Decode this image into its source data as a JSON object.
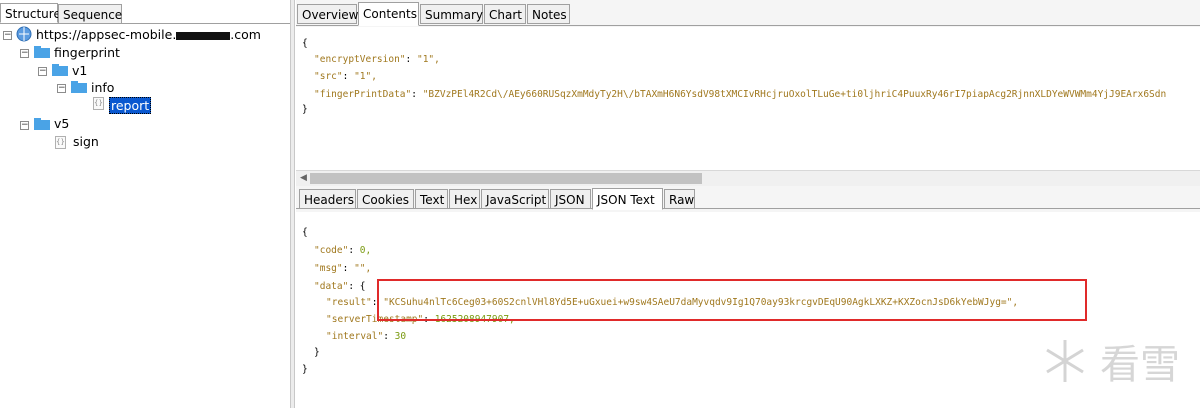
{
  "left_tabs": [
    "Structure",
    "Sequence"
  ],
  "tree": {
    "root": "https://appsec-mobile.",
    "root_suffix": ".com",
    "fingerprint": "fingerprint",
    "v1": "v1",
    "info": "info",
    "report": "report",
    "v5": "v5",
    "sign": "sign"
  },
  "top_tabs": [
    "Overview",
    "Contents",
    "Summary",
    "Chart",
    "Notes"
  ],
  "request_json": {
    "open": "{",
    "line1_key": "\"encryptVersion\"",
    "line1_val": "\"1\",",
    "line2_key": "\"src\"",
    "line2_val": "\"1\",",
    "line3_key": "\"fingerPrintData\"",
    "line3_val": "\"BZVzPEl4R2Cd\\/AEy660RUSqzXmMdyTy2H\\/bTAXmH6N6YsdV98tXMCIvRHcjruOxolTLuGe+ti0ljhriC4PuuxRy46rI7piapAcg2RjnnXLDYeWVWMm4YjJ9EArx6Sdn",
    "close": "}"
  },
  "mid_tabs": [
    "Headers",
    "Cookies",
    "Text",
    "Hex",
    "JavaScript",
    "JSON",
    "JSON Text",
    "Raw"
  ],
  "response_json": {
    "open": "{",
    "code_key": "\"code\"",
    "code_val": "0,",
    "msg_key": "\"msg\"",
    "msg_val": "\"\",",
    "data_key": "\"data\"",
    "data_open": "{",
    "result_key": "\"result\"",
    "result_val": "\"KCSuhu4nlTc6Ceg03+60S2cnlVHl8Yd5E+uGxuei+w9sw4SAeU7daMyvqdv9Ig1Q70ay93krcgvDEqU90AgkLXKZ+KXZocnJsD6kYebWJyg=\",",
    "serverT_key": "\"serverTimestamp\"",
    "serverT_val": "1625208947907,",
    "interval_key": "\"interval\"",
    "interval_val": "30",
    "data_close": "}",
    "close": "}"
  },
  "watermark": "看雪",
  "colors": {
    "highlight": "#e02a2a",
    "selection": "#0a58d0"
  }
}
